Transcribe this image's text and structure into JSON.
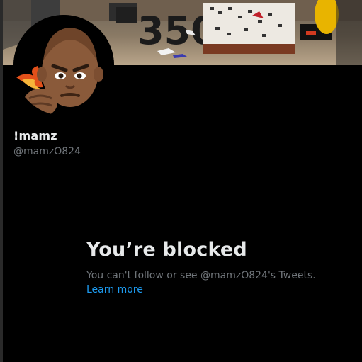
{
  "profile": {
    "display_name": "!mamz",
    "handle": "@mamzO824"
  },
  "blocked": {
    "title": "You’re blocked",
    "message": "You can't follow or see @mamzO824's Tweets. ",
    "learn_more": "Learn more"
  },
  "colors": {
    "background": "#000000",
    "primary_text": "#e7e9ea",
    "secondary_text": "#71767b",
    "link": "#1d9bf0"
  },
  "icons": {
    "banner": "header-photo",
    "avatar": "memoji-avatar"
  }
}
